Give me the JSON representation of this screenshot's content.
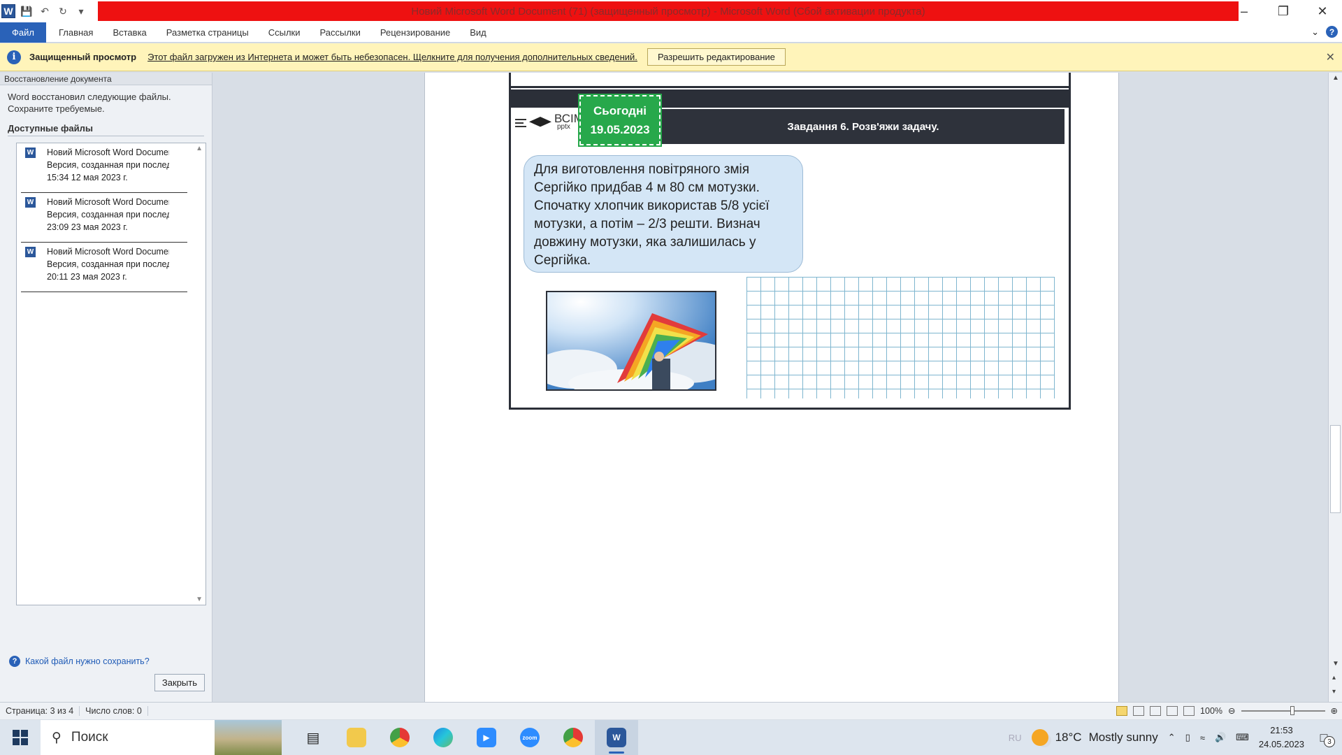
{
  "window": {
    "title": "Новий Microsoft Word Document (71) (защищенный просмотр) - Microsoft Word (Сбой активации продукта)"
  },
  "ribbon": {
    "file_tab": "Файл",
    "tabs": [
      "Главная",
      "Вставка",
      "Разметка страницы",
      "Ссылки",
      "Рассылки",
      "Рецензирование",
      "Вид"
    ]
  },
  "protected_view": {
    "title": "Защищенный просмотр",
    "message": "Этот файл загружен из Интернета и может быть небезопасен. Щелкните для получения дополнительных сведений.",
    "enable_button": "Разрешить редактирование"
  },
  "recovery_pane": {
    "header": "Восстановление документа",
    "message_line1": "Word восстановил следующие файлы.",
    "message_line2": "Сохраните требуемые.",
    "available_files_label": "Доступные файлы",
    "files": [
      {
        "name": "Новий Microsoft Word Document ...",
        "desc": "Версия, созданная при последне...",
        "time": "15:34 12 мая 2023 г."
      },
      {
        "name": "Новий Microsoft Word Document ...",
        "desc": "Версия, созданная при последне...",
        "time": "23:09 23 мая 2023 г."
      },
      {
        "name": "Новий Microsoft Word Document ...",
        "desc": "Версия, созданная при последне...",
        "time": "20:11 23 мая 2023 г."
      }
    ],
    "help_link": "Какой файл нужно сохранить?",
    "close_button": "Закрыть"
  },
  "slide": {
    "logo_text": "ВСІМ",
    "logo_sub": "pptx",
    "badge_line1": "Сьогодні",
    "badge_line2": "19.05.2023",
    "task_title": "Завдання 6. Розв'яжи задачу.",
    "problem_lines": [
      "Для виготовлення повітряного змія",
      "Сергійко придбав 4 м 80 см мотузки.",
      "Спочатку хлопчик використав 5/8 усієї",
      "мотузки, а потім – 2/3 решти. Визнач",
      "довжину мотузки, яка залишилась у",
      "Сергійка."
    ]
  },
  "statusbar": {
    "page": "Страница: 3 из 4",
    "words": "Число слов: 0",
    "zoom": "100%"
  },
  "taskbar": {
    "search_placeholder": "Поиск",
    "weather_temp": "18°C",
    "weather_desc": "Mostly sunny",
    "lang": "RU",
    "time": "21:53",
    "date": "24.05.2023",
    "notifications": "3"
  }
}
